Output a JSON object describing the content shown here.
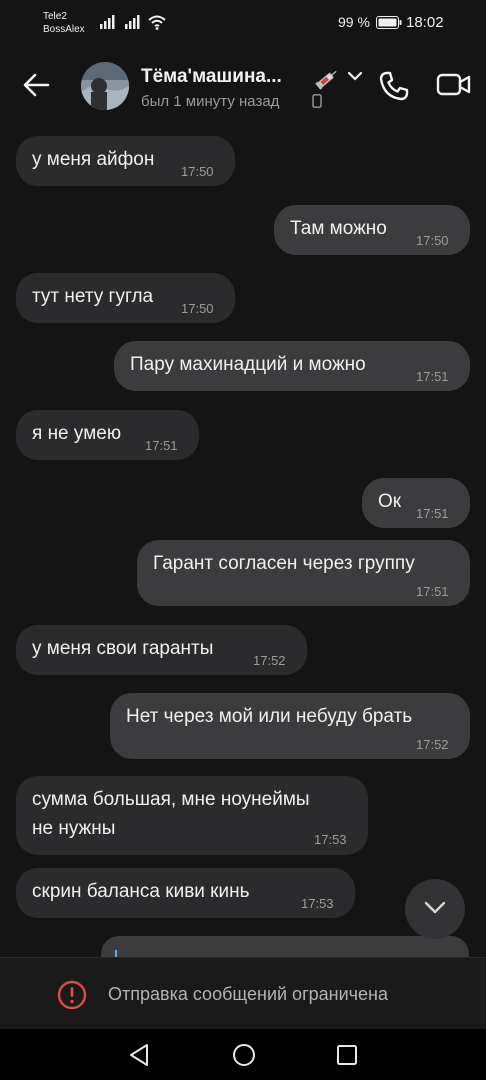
{
  "status": {
    "carrier_line1": "Tele2",
    "carrier_line2": "BossAlex",
    "battery": "99 %",
    "time": "18:02"
  },
  "header": {
    "name": "Тёма'машина...",
    "last_seen": "был 1 минуту назад",
    "emoji": "syringe"
  },
  "messages": [
    {
      "dir": "in",
      "text": "у меня айфон",
      "time": "17:50"
    },
    {
      "dir": "out",
      "text": "Там можно",
      "time": "17:50"
    },
    {
      "dir": "in",
      "text": "тут нету гугла",
      "time": "17:50"
    },
    {
      "dir": "out",
      "text": "Пару махинадций и можно",
      "time": "17:51"
    },
    {
      "dir": "in",
      "text": "я не умею",
      "time": "17:51"
    },
    {
      "dir": "out",
      "text": "Ок",
      "time": "17:51"
    },
    {
      "dir": "out",
      "text": "Гарант согласен через группу",
      "time": "17:51"
    },
    {
      "dir": "in",
      "text": "у меня свои гаранты",
      "time": "17:52"
    },
    {
      "dir": "out",
      "text": "Нет через мой или небуду брать",
      "time": "17:52"
    },
    {
      "dir": "in",
      "text": "сумма большая, мне ноунеймы",
      "text2": "не нужны",
      "time": "17:53"
    },
    {
      "dir": "in",
      "text": "скрин баланса киви кинь",
      "time": "17:53"
    }
  ],
  "restriction": {
    "text": "Отправка сообщений ограничена"
  },
  "colors": {
    "background": "#141414",
    "bubble_in": "#2b2b2d",
    "bubble_out": "#3c3c3e",
    "warning": "#e5484d",
    "reply_accent": "#6ea6e0"
  }
}
